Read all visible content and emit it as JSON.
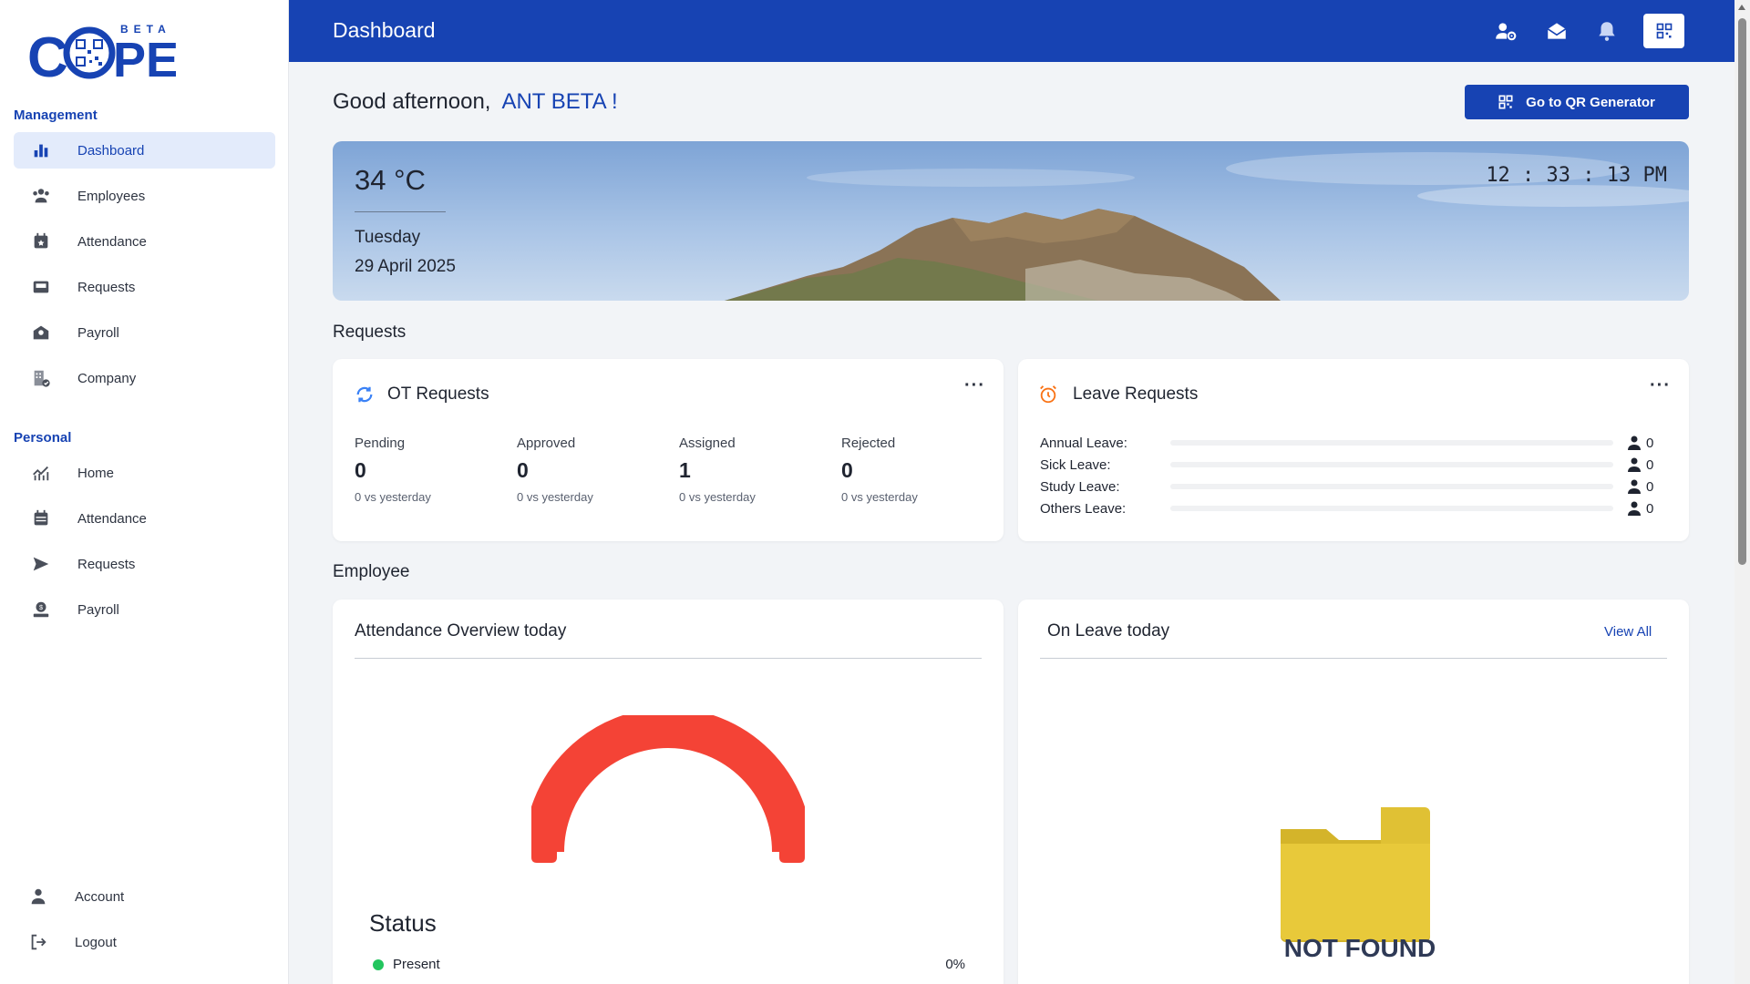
{
  "sidebar": {
    "logo_text": "COPE",
    "logo_badge": "BETA",
    "management_title": "Management",
    "management_items": [
      {
        "label": "Dashboard",
        "icon": "bar-chart-icon"
      },
      {
        "label": "Employees",
        "icon": "people-icon"
      },
      {
        "label": "Attendance",
        "icon": "calendar-star-icon"
      },
      {
        "label": "Requests",
        "icon": "inbox-icon"
      },
      {
        "label": "Payroll",
        "icon": "money-envelope-icon"
      },
      {
        "label": "Company",
        "icon": "building-check-icon"
      }
    ],
    "personal_title": "Personal",
    "personal_items": [
      {
        "label": "Home",
        "icon": "trend-chart-icon"
      },
      {
        "label": "Attendance",
        "icon": "calendar-icon"
      },
      {
        "label": "Requests",
        "icon": "send-icon"
      },
      {
        "label": "Payroll",
        "icon": "money-hand-icon"
      }
    ],
    "account_label": "Account",
    "logout_label": "Logout"
  },
  "header": {
    "title": "Dashboard",
    "icons": [
      "user-settings-icon",
      "mail-open-icon",
      "bell-icon",
      "qr-code-icon"
    ]
  },
  "greeting": {
    "prefix": "Good afternoon,",
    "name": "ANT BETA !"
  },
  "qr_button_label": "Go to QR Generator",
  "weather": {
    "temperature": "34 °C",
    "day": "Tuesday",
    "date": "29 April 2025",
    "time": "12 : 33 : 13 PM"
  },
  "requests_section_title": "Requests",
  "ot_requests": {
    "title": "OT Requests",
    "stats": [
      {
        "label": "Pending",
        "value": "0",
        "compare": "0 vs yesterday"
      },
      {
        "label": "Approved",
        "value": "0",
        "compare": "0 vs yesterday"
      },
      {
        "label": "Assigned",
        "value": "1",
        "compare": "0 vs yesterday"
      },
      {
        "label": "Rejected",
        "value": "0",
        "compare": "0 vs yesterday"
      }
    ]
  },
  "leave_requests": {
    "title": "Leave Requests",
    "rows": [
      {
        "label": "Annual Leave:",
        "count": "0",
        "fill": 0
      },
      {
        "label": "Sick Leave:",
        "count": "0",
        "fill": 0
      },
      {
        "label": "Study Leave:",
        "count": "0",
        "fill": 0
      },
      {
        "label": "Others Leave:",
        "count": "0",
        "fill": 0
      }
    ]
  },
  "employee_section_title": "Employee",
  "attendance_overview": {
    "title": "Attendance Overview today",
    "status_title": "Status",
    "legend": [
      {
        "label": "Present",
        "value": "0%",
        "color": "#22c55e"
      }
    ],
    "gauge_color": "#f44336"
  },
  "on_leave": {
    "title": "On Leave today",
    "view_all": "View All",
    "empty_text": "NOT FOUND"
  },
  "colors": {
    "primary": "#1743b3",
    "danger": "#f44336",
    "success": "#22c55e"
  }
}
